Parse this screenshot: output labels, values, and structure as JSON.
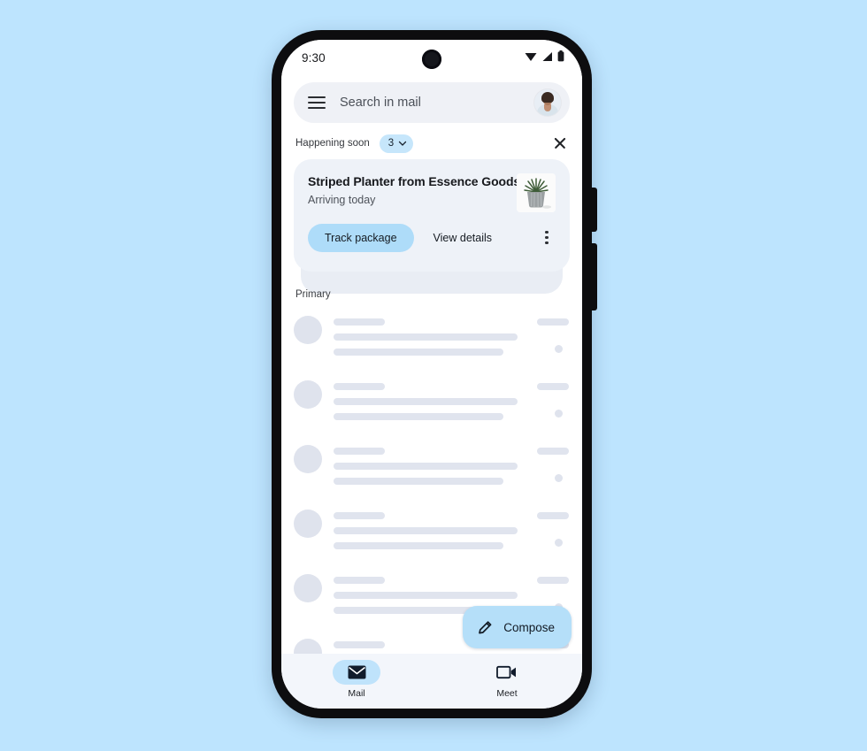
{
  "wallpaper_color": "#bde4fe",
  "phone": {
    "frame_color": "#0d0d0f",
    "screen_bg": "#ffffff"
  },
  "status_bar": {
    "time": "9:30",
    "icons": [
      "wifi-icon",
      "cellular-signal-icon",
      "battery-icon"
    ]
  },
  "search": {
    "menu_icon": "hamburger-menu-icon",
    "placeholder": "Search in mail",
    "value": "",
    "avatar": "account-avatar"
  },
  "happening_soon": {
    "label": "Happening soon",
    "count": "3",
    "chevron_icon": "chevron-down-icon",
    "chip_color": "#c6e6fb",
    "dismiss_icon": "close-icon"
  },
  "package_card": {
    "title": "Striped Planter from Essence Goods",
    "subtitle": "Arriving today",
    "thumbnail": "potted-plant-image",
    "primary_action": "Track package",
    "primary_action_color": "#aedcf9",
    "secondary_action": "View details",
    "overflow_icon": "more-vertical-icon",
    "card_color": "#eef2f8"
  },
  "mail_list": {
    "section_label": "Primary",
    "rows": [
      {
        "state": "loading-placeholder"
      },
      {
        "state": "loading-placeholder"
      },
      {
        "state": "loading-placeholder"
      },
      {
        "state": "loading-placeholder"
      },
      {
        "state": "loading-placeholder"
      },
      {
        "state": "loading-placeholder"
      }
    ]
  },
  "compose": {
    "label": "Compose",
    "icon": "pencil-icon",
    "color": "#b5dff9"
  },
  "bottom_nav": {
    "items": [
      {
        "label": "Mail",
        "icon": "envelope-icon",
        "active": true
      },
      {
        "label": "Meet",
        "icon": "video-camera-icon",
        "active": false
      }
    ],
    "active_pill_color": "#bfe3fb",
    "bar_color": "#f3f6fb"
  }
}
